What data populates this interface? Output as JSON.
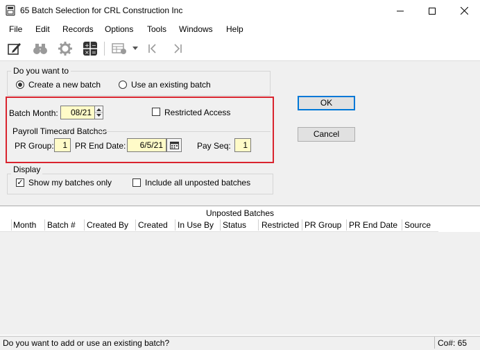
{
  "window": {
    "title": "65 Batch Selection for CRL Construction Inc",
    "controls": [
      "minimize",
      "maximize",
      "close"
    ]
  },
  "menu": [
    "File",
    "Edit",
    "Records",
    "Options",
    "Tools",
    "Windows",
    "Help"
  ],
  "toolbar": {
    "icons": [
      "edit-icon",
      "binoculars-icon",
      "gear-icon",
      "calculator-icon",
      "grid-icon",
      "dropdown-arrow-icon",
      "first-record-icon",
      "last-record-icon"
    ]
  },
  "batch_choice": {
    "group_label": "Do you want to",
    "create_label": "Create a new batch",
    "existing_label": "Use an existing batch",
    "selected": "create"
  },
  "batch_month": {
    "label": "Batch Month:",
    "value": "08/21"
  },
  "restricted": {
    "label": "Restricted Access",
    "checked": false
  },
  "payroll": {
    "group_label": "Payroll Timecard Batches",
    "pr_group_label": "PR Group:",
    "pr_group_value": "1",
    "pr_end_date_label": "PR End Date:",
    "pr_end_date_value": "6/5/21",
    "pay_seq_label": "Pay Seq:",
    "pay_seq_value": "1"
  },
  "buttons": {
    "ok": "OK",
    "cancel": "Cancel"
  },
  "display": {
    "group_label": "Display",
    "show_mine_label": "Show my batches only",
    "show_mine_checked": true,
    "include_unposted_label": "Include all unposted batches",
    "include_unposted_checked": false
  },
  "grid": {
    "title": "Unposted Batches",
    "columns": [
      "Month",
      "Batch #",
      "Created By",
      "Created",
      "In Use By",
      "Status",
      "Restricted",
      "PR Group",
      "PR End Date",
      "Source"
    ],
    "rows": []
  },
  "status": {
    "message": "Do you want to add or use an existing batch?",
    "company": "Co#: 65"
  },
  "colors": {
    "accent": "#0078d7",
    "highlight_box": "#d9232e",
    "field_bg": "#fffbc8"
  }
}
